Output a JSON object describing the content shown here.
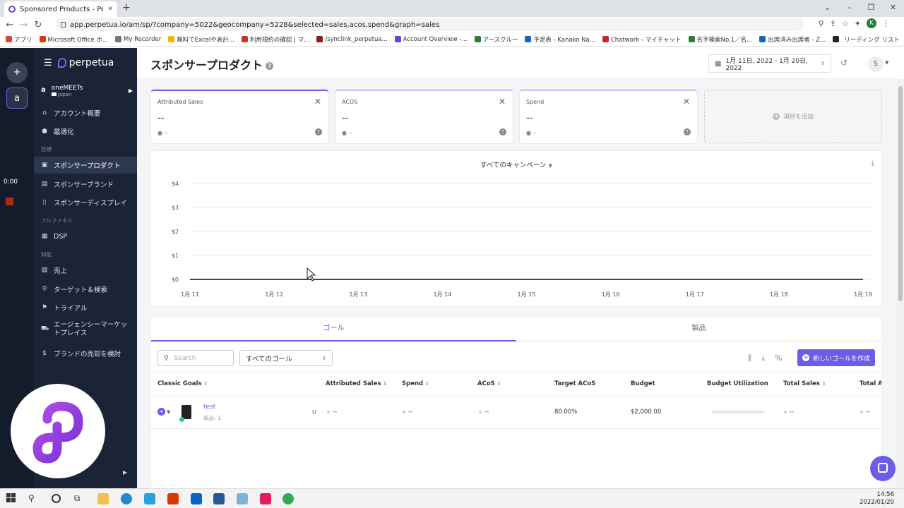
{
  "browser": {
    "tab_title": "Sponsored Products - Perpetua",
    "new_tab": "+",
    "url": "app.perpetua.io/am/sp/?company=5022&geocompany=5228&selected=sales,acos,spend&graph=sales",
    "profile_initial": "K",
    "win_min": "–",
    "win_restore": "❐",
    "win_close": "✕",
    "bookmarks": [
      {
        "label": "アプリ",
        "color": "#e04040"
      },
      {
        "label": "Microsoft Office ホ...",
        "color": "#d83b01"
      },
      {
        "label": "My Recorder",
        "color": "#777777"
      },
      {
        "label": "無料でExcelや表計...",
        "color": "#f4b400"
      },
      {
        "label": "利用規約の確認 | マ...",
        "color": "#c0392b"
      },
      {
        "label": "/synclink_perpetua...",
        "color": "#8e1b1b"
      },
      {
        "label": "Account Overview -...",
        "color": "#6c3fd9"
      },
      {
        "label": "アースクルー",
        "color": "#2e7d32"
      },
      {
        "label": "予定表 - Kanako Na...",
        "color": "#1565c0"
      },
      {
        "label": "Chatwork - マイチャット",
        "color": "#c62828"
      },
      {
        "label": "名字検索No.1／名...",
        "color": "#2e7d32"
      },
      {
        "label": "出席済み出席者 - Z...",
        "color": "#1565c0"
      }
    ],
    "bookmarks_more": "»",
    "reading_list": "リーディング リスト"
  },
  "rail": {
    "timer": "0:00",
    "icon_add": "+",
    "icon_amazon": "a"
  },
  "sidebar": {
    "brand": "perpetua",
    "account_name": "oneMEETs",
    "account_country": "Japan",
    "amazon_mark": "a",
    "items_top": [
      {
        "label": "アカウント概要",
        "icon": "⌂"
      },
      {
        "label": "最適化",
        "icon": "●"
      }
    ],
    "section_goals": "目標",
    "items_goals": [
      {
        "label": "スポンサープロダクト",
        "icon": "▣"
      },
      {
        "label": "スポンサーブランド",
        "icon": "▤"
      },
      {
        "label": "スポンサーディスプレイ",
        "icon": "▯"
      }
    ],
    "section_funnel": "フルファネル",
    "items_funnel": [
      {
        "label": "DSP",
        "icon": "▦"
      }
    ],
    "section_insights": "知能",
    "items_insights": [
      {
        "label": "売上",
        "icon": "▨"
      },
      {
        "label": "ターゲット＆検索",
        "icon": "⚲"
      },
      {
        "label": "トライアル",
        "icon": "⚑"
      },
      {
        "label": "エージェンシーマーケットプレイス",
        "icon": "⛟"
      },
      {
        "label": "ブランドの売却を検討",
        "icon": "$"
      }
    ]
  },
  "header": {
    "title": "スポンサープロダクト",
    "help": "?",
    "date_range": "1月 11日, 2022 - 1月 20日, 2022",
    "user_initial": "S"
  },
  "metrics": [
    {
      "label": "Attributed Sales",
      "value": "--",
      "sub": "--"
    },
    {
      "label": "ACOS",
      "value": "--",
      "sub": "--"
    },
    {
      "label": "Spend",
      "value": "--",
      "sub": "--"
    }
  ],
  "add_metric": "項目を追加",
  "chart_data": {
    "type": "line",
    "title": "すべてのキャンペーン",
    "x": [
      "1月 11",
      "1月 12",
      "1月 13",
      "1月 14",
      "1月 15",
      "1月 16",
      "1月 17",
      "1月 18",
      "1月 19"
    ],
    "y_ticks": [
      "$0",
      "$1",
      "$2",
      "$3",
      "$4"
    ],
    "ylim": [
      0,
      4
    ],
    "series": [
      {
        "values": [
          0,
          0,
          0,
          0,
          0,
          0,
          0,
          0,
          0
        ],
        "color": "#3b3b98"
      }
    ],
    "grid": true
  },
  "panel": {
    "tab_goals": "ゴール",
    "tab_products": "製品",
    "search_placeholder": "Search",
    "goal_filter": "すべてのゴール",
    "new_goal": "新しいゴールを作成",
    "percent": "%",
    "columns": [
      {
        "label": "Classic Goals",
        "sort": true
      },
      {
        "label": "Attributed Sales",
        "sort": true
      },
      {
        "label": "Spend",
        "sort": true
      },
      {
        "label": "ACoS",
        "sort": true
      },
      {
        "label": "Target ACoS",
        "sort": false
      },
      {
        "label": "Budget",
        "sort": false
      },
      {
        "label": "Budget Utilization",
        "sort": false
      },
      {
        "label": "Total Sales",
        "sort": true
      },
      {
        "label": "Total AC",
        "sort": false
      }
    ],
    "rows": [
      {
        "name": "test",
        "sub": "製品: 1",
        "u": "U",
        "attributed_sales": "--",
        "spend": "--",
        "acos": "--",
        "target_acos": "80.00%",
        "budget": "$2,000.00",
        "budget_utilization": 0,
        "total_sales": "--",
        "total_acos": "--"
      }
    ]
  },
  "taskbar": {
    "time": "14:56",
    "date": "2022/01/20"
  }
}
